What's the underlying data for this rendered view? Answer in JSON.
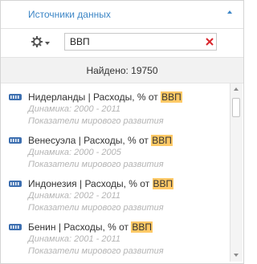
{
  "header": {
    "title": "Источники данных",
    "collapse_icon": "chevron-up-icon"
  },
  "toolbar": {
    "settings_icon": "gear-icon",
    "dropdown_icon": "caret-down-icon",
    "search": {
      "value": "ВВП",
      "clear_icon": "close-icon"
    }
  },
  "results": {
    "found_label": "Найдено: 19750"
  },
  "items": [
    {
      "country": "Нидерланды | Расходы, % от ",
      "highlight": "ВВП",
      "dynamics": "Динамика: 2000 - 2011",
      "source": "Показатели мирового развития"
    },
    {
      "country": "Венесуэла | Расходы, % от ",
      "highlight": "ВВП",
      "dynamics": "Динамика: 2000 - 2005",
      "source": "Показатели мирового развития"
    },
    {
      "country": "Индонезия | Расходы, % от ",
      "highlight": "ВВП",
      "dynamics": "Динамика: 2002 - 2011",
      "source": "Показатели мирового развития"
    },
    {
      "country": "Бенин | Расходы, % от ",
      "highlight": "ВВП",
      "dynamics": "Динамика: 2001 - 2011",
      "source": "Показатели мирового развития"
    }
  ],
  "colors": {
    "accent": "#3d86c6",
    "highlight": "#ffc966",
    "clear": "#d9262c",
    "muted": "#b4b4b4"
  }
}
